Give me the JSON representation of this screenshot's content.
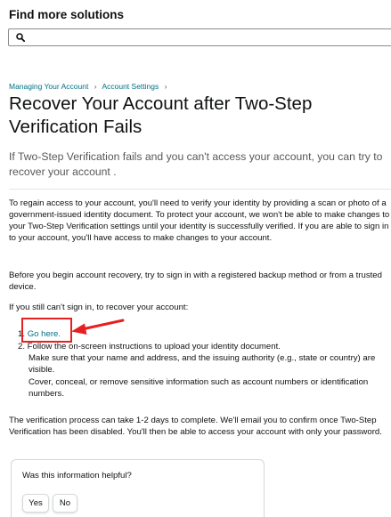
{
  "sidebar": {
    "title": "Find more solutions",
    "search": {
      "value": "",
      "placeholder": ""
    }
  },
  "breadcrumb": {
    "items": [
      "Managing Your Account",
      "Account Settings"
    ],
    "separator": "›"
  },
  "article": {
    "title": "Recover Your Account after Two-Step Verification Fails",
    "intro": "If Two-Step Verification fails and you can't access your account, you can try to recover your account .",
    "paragraphs": [
      "To regain access to your account, you'll need to verify your identity by providing a scan or photo of a government-issued identity document. To protect your account, we won't be able to make changes to your Two-Step Verification settings until your identity is successfully verified. If you are able to sign in to your account, you'll have access to make changes to your account.",
      "Before you begin account recovery, try to sign in with a registered backup method or from a trusted device.",
      "If you still can't sign in, to recover your account:"
    ],
    "steps": {
      "step1_number": "1.",
      "step1_link": "Go here.",
      "step2": "2. Follow the on-screen instructions to upload your identity document.",
      "sub1": "Make sure that your name and address, and the issuing authority (e.g., state or country) are visible.",
      "sub2": "Cover, conceal, or remove sensitive information such as account numbers or identification numbers."
    },
    "closing": "The verification process can take 1-2 days to complete. We'll email you to confirm once Two-Step Verification has been disabled. You'll then be able to access your account with only your password."
  },
  "feedback": {
    "question": "Was this information helpful?",
    "yes_label": "Yes",
    "no_label": "No"
  },
  "colors": {
    "link": "#007185",
    "annotation": "#e62020",
    "text": "#0f1111",
    "muted": "#565959"
  }
}
